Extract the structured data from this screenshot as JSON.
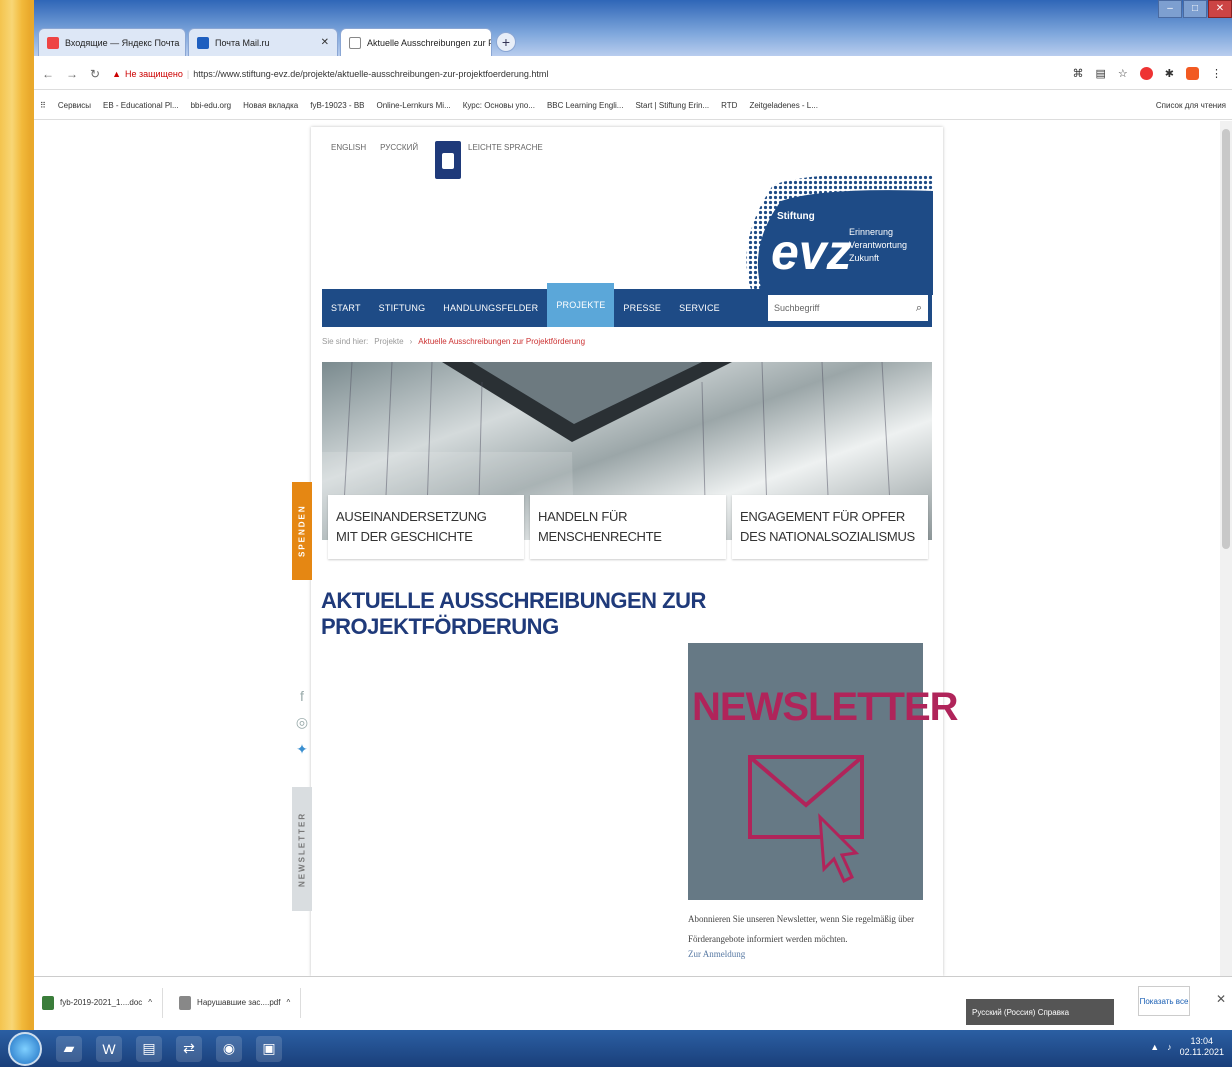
{
  "browser": {
    "tabs": [
      {
        "label": "Входящие — Яндекс Почта"
      },
      {
        "label": "Почта Mail.ru"
      },
      {
        "label": "Aktuelle Ausschreibungen zur P..."
      }
    ],
    "address": {
      "security_label": "Не защищено",
      "url": "https://www.stiftung-evz.de/projekte/aktuelle-ausschreibungen-zur-projektfoerderung.html"
    },
    "bookmarks": [
      "Сервисы",
      "ЕВ - Educational Pl...",
      "bbi-edu.org",
      "Новая вкладка",
      "fyB-19023 - ВВ",
      "Online-Lernkurs Mi...",
      "Курс: Основы упо...",
      "BBC Learning Engli...",
      "Start | Stiftung Erin...",
      "RTD",
      "Zeitgeladenes - L..."
    ],
    "bookmarks_other": "Список для чтения"
  },
  "site": {
    "lang_links": [
      "ENGLISH",
      "РУССКИЙ"
    ],
    "easy_language": "LEICHTE SPRACHE",
    "logo": {
      "word": "evz",
      "prefix": "Stiftung",
      "tagline": [
        "Erinnerung",
        "Verantwortung",
        "Zukunft"
      ]
    },
    "nav": [
      "START",
      "STIFTUNG",
      "HANDLUNGSFELDER",
      "PROJEKTE",
      "PRESSE",
      "SERVICE"
    ],
    "nav_active": "PROJEKTE",
    "search_placeholder": "Suchbegriff",
    "breadcrumb": {
      "prefix": "Sie sind hier:",
      "items": [
        "Projekte"
      ],
      "current": "Aktuelle Ausschreibungen zur Projektförderung"
    },
    "cards": [
      {
        "line1": "AUSEINANDERSETZUNG",
        "line2": "MIT DER GESCHICHTE"
      },
      {
        "line1": "HANDELN FÜR",
        "line2": "MENSCHENRECHTE"
      },
      {
        "line1": "ENGAGEMENT FÜR OPFER",
        "line2": "DES NATIONALSOZIALISMUS"
      }
    ],
    "side_spenden": "SPENDEN",
    "side_newsletter": "NEWSLETTER",
    "page_title": "AKTUELLE AUSSCHREIBUNGEN ZUR PROJEKTFÖRDERUNG",
    "newsletter": {
      "image_word": "NEWSLETTER",
      "text": "Abonnieren Sie unseren Newsletter, wenn Sie regelmäßig über Förderangebote informiert werden möchten.",
      "link": "Zur Anmeldung"
    }
  },
  "downloads": [
    {
      "name": "fyb-2019-2021_1....doc"
    },
    {
      "name": "Нарушавшие зас....pdf"
    }
  ],
  "downloads_show_all": "Показать все",
  "language_bar": "Русский (Россия)  Справка",
  "tray": {
    "time": "13:04",
    "date": "02.11.2021"
  },
  "colors": {
    "nav": "#1e4b86",
    "nav_active": "#5ba7d9",
    "title": "#1f3a7a",
    "spenden": "#e58713",
    "newsletter_bg": "#667985",
    "newsletter_word": "#b0245a"
  }
}
